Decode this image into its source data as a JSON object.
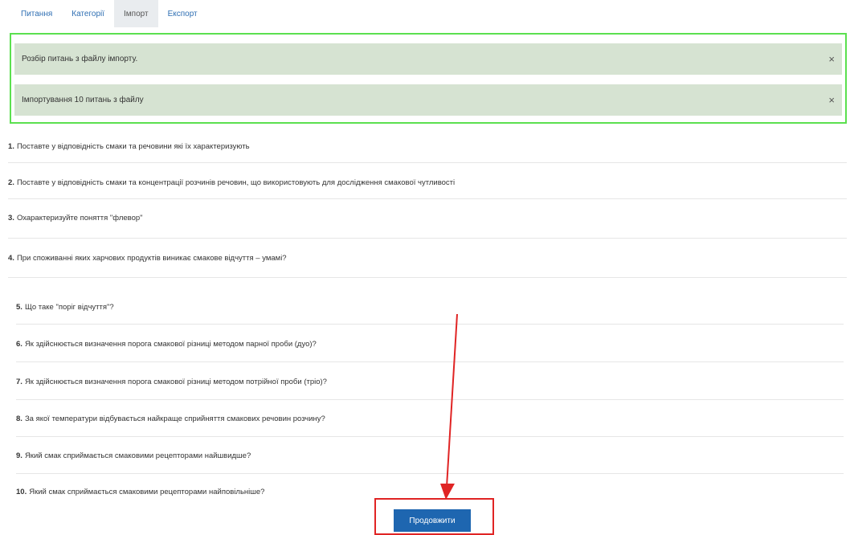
{
  "tabs": [
    {
      "label": "Питання"
    },
    {
      "label": "Категорії"
    },
    {
      "label": "Імпорт"
    },
    {
      "label": "Експорт"
    }
  ],
  "alerts": [
    {
      "text": "Розбір питань з файлу імпорту."
    },
    {
      "text": "Імпортування 10 питань з файлу"
    }
  ],
  "close_symbol": "×",
  "questions": [
    {
      "num": "1.",
      "text": "Поставте у відповідність смаки та речовини які їх характеризують"
    },
    {
      "num": "2.",
      "text": "Поставте у відповідність смаки та концентрації розчинів речовин, що використовують для дослідження смакової чутливості"
    },
    {
      "num": "3.",
      "text": "Охарактеризуйте поняття \"флевор\""
    },
    {
      "num": "4.",
      "text": "При споживанні яких харчових продуктів виникає смакове відчуття – умамі?"
    },
    {
      "num": "5.",
      "text": "Що таке \"поріг відчуття\"?"
    },
    {
      "num": "6.",
      "text": "Як здійснюється визначення порога смакової різниці методом парної проби (дуо)?"
    },
    {
      "num": "7.",
      "text": "Як здійснюється визначення порога смакової різниці методом потрійної проби (тріо)?"
    },
    {
      "num": "8.",
      "text": "За якої температури відбувається найкраще сприйняття смакових речовин розчину?"
    },
    {
      "num": "9.",
      "text": "Який смак сприймається смаковими рецепторами найшвидше?"
    },
    {
      "num": "10.",
      "text": "Який смак сприймається смаковими рецепторами найповільніше?"
    }
  ],
  "continue_label": "Продовжити",
  "colors": {
    "tab_link": "#2f6fb3",
    "alert_bg": "#d6e3d2",
    "highlight_green": "#5be04f",
    "highlight_red": "#e02424",
    "button_bg": "#1e66b0"
  }
}
